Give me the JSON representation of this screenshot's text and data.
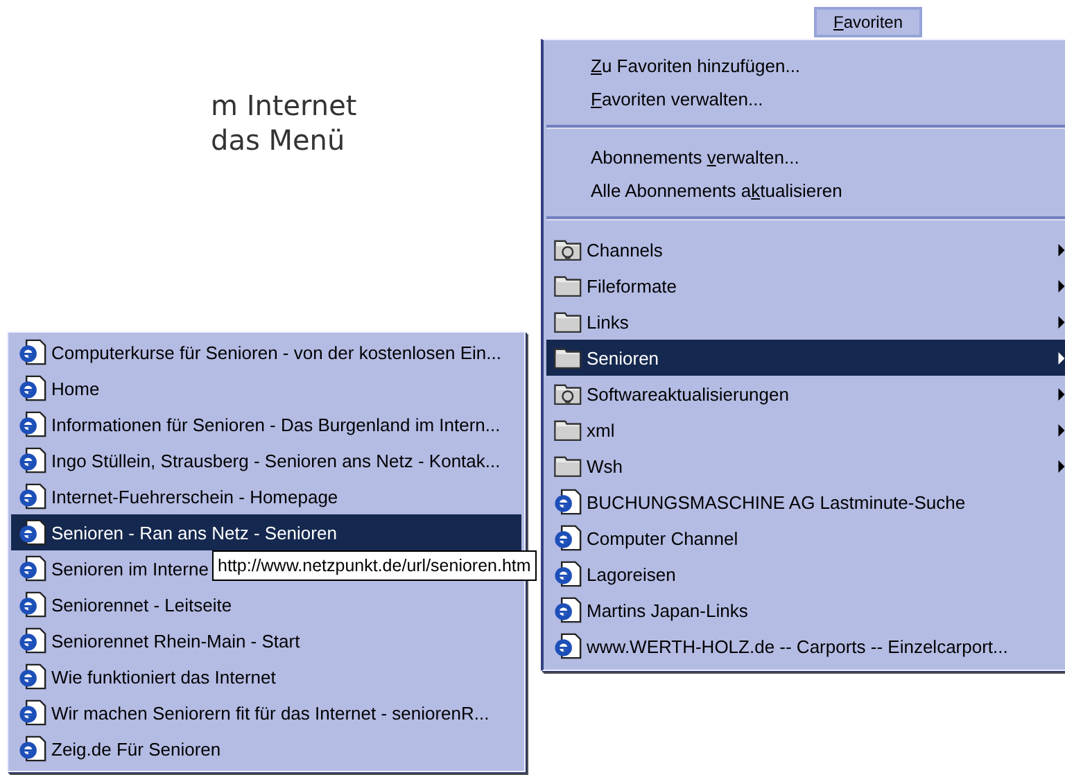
{
  "intro_lines": [
    "m Internet",
    "das Menü"
  ],
  "menu_button": {
    "access_key": "F",
    "label_rest": "avoriten",
    "selected": true
  },
  "menu": [
    {
      "kind": "command",
      "access_key": "Z",
      "label_rest": "u Favoriten hinzufügen...",
      "selected": false
    },
    {
      "kind": "command",
      "access_key": "F",
      "label_rest": "avoriten verwalten...",
      "selected": false
    },
    {
      "kind": "separator"
    },
    {
      "kind": "command",
      "label_start": "Abonnements ",
      "access_key": "v",
      "label_rest": "erwalten...",
      "selected": false
    },
    {
      "kind": "command",
      "label_start": "Alle Abonnements a",
      "access_key": "k",
      "label_rest": "tualisieren",
      "selected": false
    },
    {
      "kind": "separator"
    },
    {
      "kind": "channel-folder",
      "label": "Channels",
      "selected": false
    },
    {
      "kind": "folder",
      "label": "Fileformate",
      "selected": false
    },
    {
      "kind": "folder",
      "label": "Links",
      "selected": false
    },
    {
      "kind": "folder",
      "label": "Senioren",
      "selected": true
    },
    {
      "kind": "channel-folder",
      "label": "Softwareaktualisierungen",
      "selected": false
    },
    {
      "kind": "folder",
      "label": "xml",
      "selected": false
    },
    {
      "kind": "folder",
      "label": "Wsh",
      "selected": false
    },
    {
      "kind": "link",
      "label": "BUCHUNGSMASCHINE AG Lastminute-Suche",
      "selected": false
    },
    {
      "kind": "link",
      "label": "Computer Channel",
      "selected": false
    },
    {
      "kind": "link",
      "label": "Lagoreisen",
      "selected": false
    },
    {
      "kind": "link",
      "label": "Martins Japan-Links",
      "selected": false
    },
    {
      "kind": "link",
      "label": "www.WERTH-HOLZ.de -- Carports -- Einzelcarport...",
      "selected": false
    }
  ],
  "submenu": [
    {
      "label": "Computerkurse für Senioren - von der kostenlosen Ein...",
      "selected": false
    },
    {
      "label": "Home",
      "selected": false
    },
    {
      "label": "Informationen für Senioren - Das Burgenland im Intern...",
      "selected": false
    },
    {
      "label": "Ingo Stüllein, Strausberg - Senioren ans Netz - Kontak...",
      "selected": false
    },
    {
      "label": "Internet-Fuehrerschein - Homepage",
      "selected": false
    },
    {
      "label": "Senioren - Ran ans Netz - Senioren",
      "selected": true
    },
    {
      "label": "Senioren im Interne",
      "selected": false
    },
    {
      "label": "Seniorennet - Leitseite",
      "selected": false
    },
    {
      "label": "Seniorennet Rhein-Main - Start",
      "selected": false
    },
    {
      "label": "Wie funktioniert das Internet",
      "selected": false
    },
    {
      "label": "Wir machen Seniorern fit für das Internet - seniorenR...",
      "selected": false
    },
    {
      "label": "Zeig.de Für Senioren",
      "selected": false
    }
  ],
  "tooltip": "http://www.netzpunkt.de/url/senioren.htm"
}
